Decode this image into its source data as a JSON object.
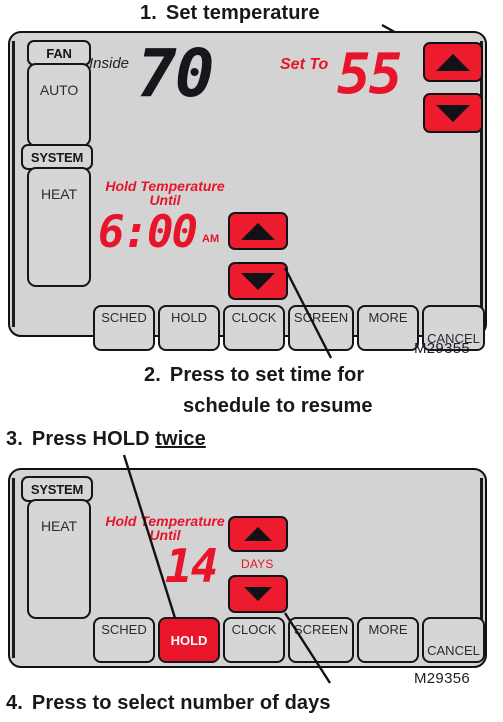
{
  "steps": [
    {
      "num": "1.",
      "text": "Set temperature"
    },
    {
      "num": "2.",
      "line1": "Press to set time for",
      "line2": "schedule to resume"
    },
    {
      "num": "3.",
      "pre": "Press ",
      "strong": "HOLD",
      "underline": "twice"
    },
    {
      "num": "4.",
      "text": "Press to select number of days"
    }
  ],
  "colors": {
    "red": "#ed1b2e",
    "lcd_red": "#e8142a",
    "panel_bg": "#d3d3d3",
    "key_bg": "#d6d6d6",
    "outline": "#111111"
  },
  "thermostat_top": {
    "model": "M29355",
    "fan": {
      "tab": "FAN",
      "mode": "AUTO"
    },
    "system": {
      "tab": "SYSTEM",
      "mode": "HEAT"
    },
    "display": {
      "inside_label": "Inside",
      "inside_value": "70",
      "setto_label": "Set To",
      "setto_value": "55",
      "hold_line1": "Hold Temperature",
      "hold_line2": "Until",
      "time_value": "6:00",
      "time_meridiem": "AM"
    },
    "arrows": {
      "temp_up": "temperature-up",
      "temp_down": "temperature-down",
      "time_up": "time-up",
      "time_down": "time-down"
    },
    "keys": [
      "SCHED",
      "HOLD",
      "CLOCK",
      "SCREEN",
      "MORE",
      "CANCEL"
    ]
  },
  "thermostat_bottom": {
    "model": "M29356",
    "system": {
      "tab": "SYSTEM",
      "mode": "HEAT"
    },
    "display": {
      "hold_line1": "Hold Temperature",
      "hold_line2": "Until",
      "days_value": "14",
      "days_label": "DAYS"
    },
    "arrows": {
      "days_up": "days-up",
      "days_down": "days-down"
    },
    "keys": [
      "SCHED",
      "HOLD",
      "CLOCK",
      "SCREEN",
      "MORE",
      "CANCEL"
    ],
    "active_key": "HOLD"
  }
}
